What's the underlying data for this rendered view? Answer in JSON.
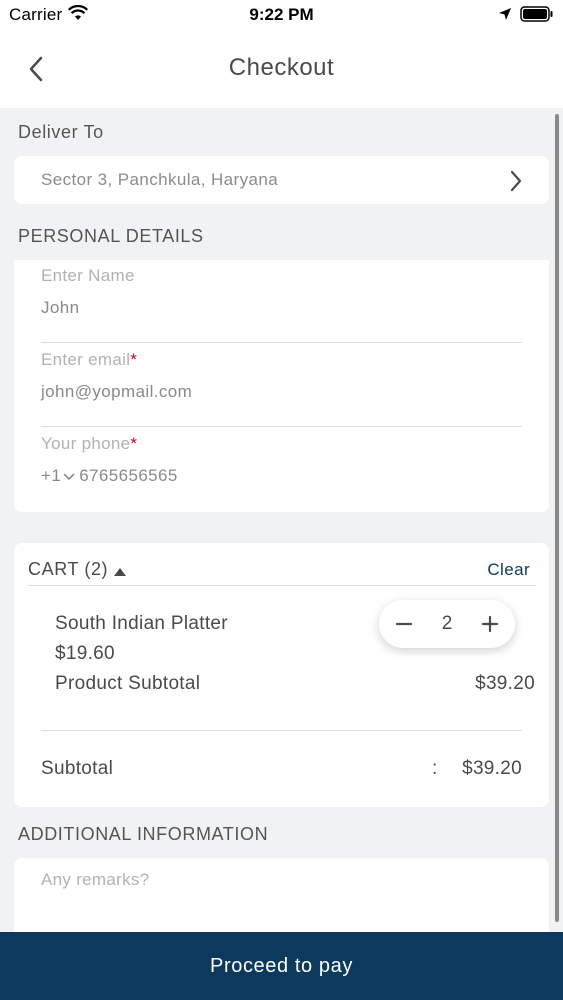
{
  "status_bar": {
    "carrier": "Carrier",
    "time": "9:22 PM"
  },
  "nav": {
    "title": "Checkout",
    "back_icon": "chevron-left-icon"
  },
  "delivery": {
    "label": "Deliver To",
    "address": "Sector 3, Panchkula, Haryana"
  },
  "personal_details": {
    "heading": "PERSONAL DETAILS",
    "name": {
      "label": "Enter Name",
      "value": "John"
    },
    "email": {
      "label": "Enter email",
      "required_mark": "*",
      "value": "john@yopmail.com"
    },
    "phone": {
      "label": "Your phone",
      "required_mark": "*",
      "country_code": "+1",
      "value": "6765656565"
    }
  },
  "cart": {
    "header": "CART (2)",
    "clear_label": "Clear",
    "item": {
      "name": "South Indian Platter",
      "price": "$19.60",
      "quantity": "2",
      "subtotal_label": "Product Subtotal",
      "subtotal_value": "$39.20"
    },
    "subtotal_label": "Subtotal",
    "subtotal_separator": ":",
    "subtotal_value": "$39.20"
  },
  "additional_info": {
    "heading": "ADDITIONAL INFORMATION",
    "placeholder": "Any remarks?"
  },
  "footer": {
    "button_label": "Proceed to pay",
    "color": "#0b3a5c"
  },
  "colors": {
    "accent": "#0d3b5f",
    "required": "#d0021b"
  }
}
